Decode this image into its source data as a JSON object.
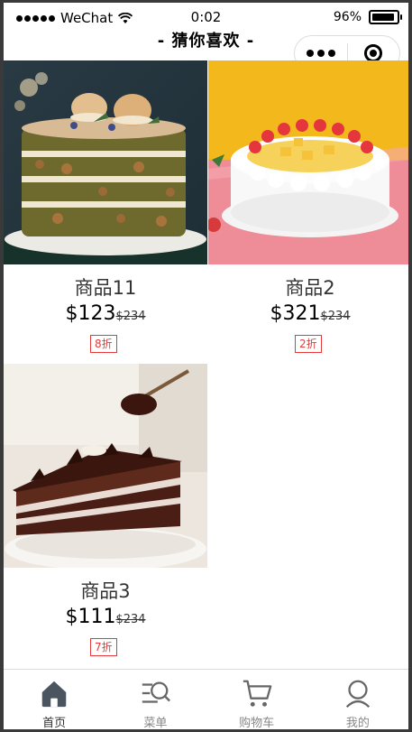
{
  "status_bar": {
    "carrier": "WeChat",
    "time": "0:02",
    "battery": "96%"
  },
  "nav": {
    "title": "-  猜你喜欢  -"
  },
  "products": [
    {
      "name": "商品11",
      "price": "$123",
      "original_price": "$234",
      "discount": "8折",
      "image": "layered-matcha-cake-with-macarons"
    },
    {
      "name": "商品2",
      "price": "$321",
      "original_price": "$234",
      "discount": "2折",
      "image": "white-cream-fruit-cake"
    },
    {
      "name": "商品3",
      "price": "$111",
      "original_price": "$234",
      "discount": "7折",
      "image": "chocolate-layer-cake-slice"
    }
  ],
  "tabbar": {
    "items": [
      {
        "label": "首页",
        "icon": "home-icon",
        "active": true
      },
      {
        "label": "菜单",
        "icon": "menu-search-icon",
        "active": false
      },
      {
        "label": "购物车",
        "icon": "cart-icon",
        "active": false
      },
      {
        "label": "我的",
        "icon": "user-icon",
        "active": false
      }
    ]
  },
  "colors": {
    "discount_tag": "#e63a3a",
    "active_tab_icon": "#4b5560",
    "inactive_tab_icon": "#666666"
  }
}
